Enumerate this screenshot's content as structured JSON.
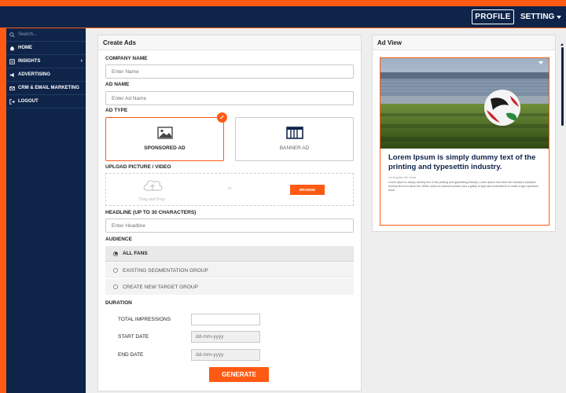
{
  "header": {
    "profile_label": "PROFILE",
    "setting_label": "SETTING"
  },
  "sidebar": {
    "search_placeholder": "Search...",
    "items": [
      {
        "label": "HOME",
        "icon": "home-icon"
      },
      {
        "label": "INSIGHTS",
        "icon": "insights-icon"
      },
      {
        "label": "ADVERTISING",
        "icon": "megaphone-icon"
      },
      {
        "label": "CRM & EMAIL MARKETING",
        "icon": "envelope-icon"
      },
      {
        "label": "LOGOUT",
        "icon": "logout-icon"
      }
    ]
  },
  "create_ads": {
    "title": "Create Ads",
    "company_name": {
      "label": "COMPANY NAME",
      "placeholder": "Enter Name",
      "value": ""
    },
    "ad_name": {
      "label": "AD NAME",
      "placeholder": "Enter Ad Name",
      "value": ""
    },
    "ad_type": {
      "label": "AD TYPE",
      "options": [
        {
          "label": "SPONSORED AD",
          "icon": "image-icon",
          "selected": true
        },
        {
          "label": "BANNER AD",
          "icon": "banner-icon",
          "selected": false
        }
      ]
    },
    "upload": {
      "label": "UPLOAD PICTURE / VIDEO",
      "drag_text": "Drag and Drop",
      "separator": "or",
      "browse_label": "BROWSE"
    },
    "headline": {
      "label": "HEADLINE (UP TO 30 CHARACTERS)",
      "placeholder": "Enter Headline",
      "value": ""
    },
    "audience": {
      "label": "AUDIENCE",
      "options": [
        {
          "label": "ALL FANS",
          "selected": true
        },
        {
          "label": "EXISTING SEGMENTATION GROUP",
          "selected": false
        },
        {
          "label": "CREATE NEW TARGET GROUP",
          "selected": false
        }
      ]
    },
    "duration": {
      "label": "DURATION",
      "total_impressions": {
        "label": "TOTAL IMPRESSIONS",
        "value": ""
      },
      "start_date": {
        "label": "START DATE",
        "placeholder": "dd-mm-yyyy"
      },
      "end_date": {
        "label": "END DATE",
        "placeholder": "dd-mm-yyyy"
      }
    },
    "generate_label": "GENERATE"
  },
  "ad_view": {
    "title": "Ad View",
    "ad_headline": "Lorem Ipsum is simply dummy text of the printing and typesettin industry.",
    "ad_subtext": "Lid Supplies 9th hanks",
    "ad_body": "Lorem Ipsum is simply dummy text of the printing and typesetting industry. Lorem Ipsum has been the industry's standard dummy text ever since the 1500s, when an unknown printer took a galley of type and scrambled it to make a type specimen book."
  },
  "colors": {
    "accent": "#ff5a14",
    "navy": "#0e2449",
    "panel_bg": "#eeeeee"
  }
}
